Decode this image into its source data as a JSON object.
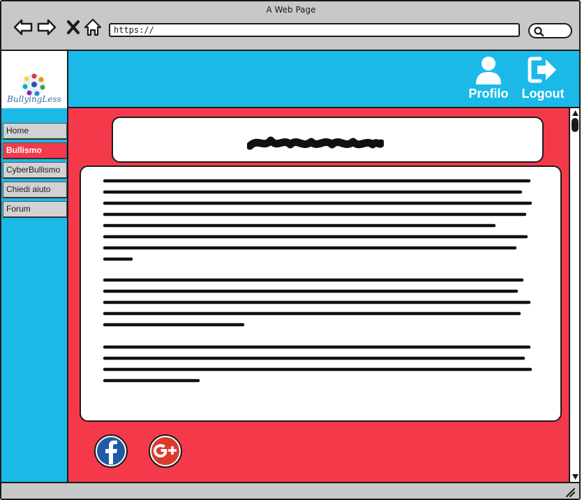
{
  "window": {
    "title": "A Web Page"
  },
  "browser": {
    "url": "https://",
    "icons": [
      "back-arrow-icon",
      "forward-arrow-icon",
      "close-x-icon",
      "home-icon",
      "search-icon"
    ]
  },
  "brand": {
    "logo_text": "BullyingLess"
  },
  "header": {
    "profile_label": "Profilo",
    "logout_label": "Logout"
  },
  "sidebar": {
    "items": [
      {
        "label": "Home",
        "active": false
      },
      {
        "label": "Bullismo",
        "active": true
      },
      {
        "label": "CyberBullismo",
        "active": false
      },
      {
        "label": "Chiedi aiuto",
        "active": false
      },
      {
        "label": "Forum",
        "active": false
      }
    ]
  },
  "colors": {
    "header_bg": "#1bb9e8",
    "main_bg": "#f43a4a",
    "chrome_bg": "#c8c8c8",
    "active_item": "#f43a4a"
  },
  "social": {
    "icons": [
      "facebook-icon",
      "google-plus-icon"
    ]
  }
}
